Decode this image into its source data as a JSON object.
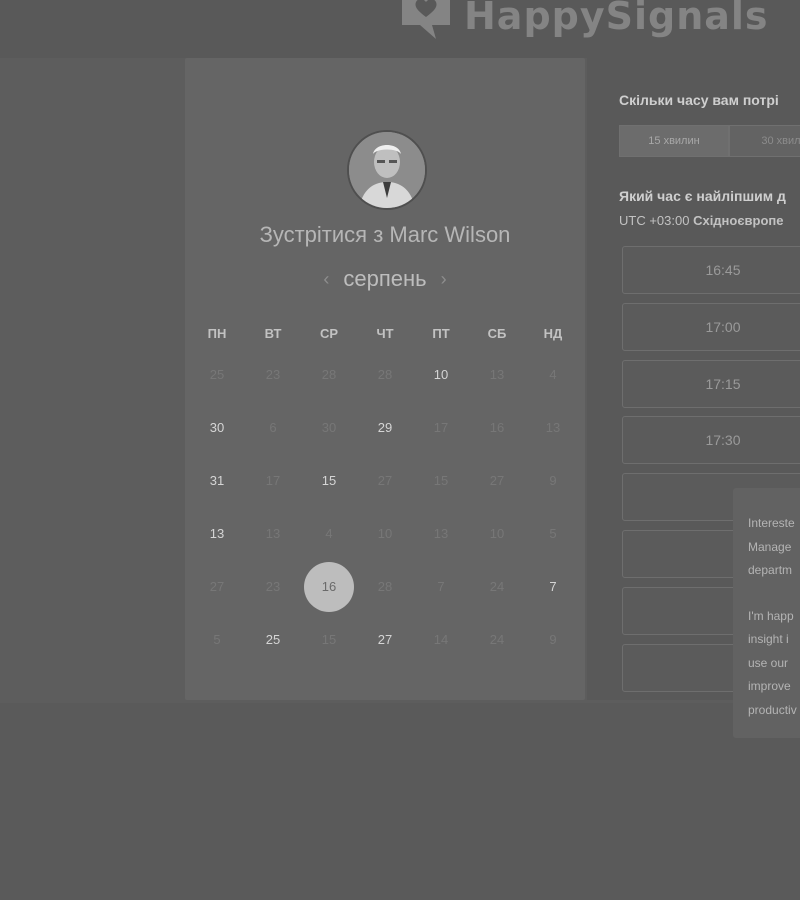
{
  "brand": {
    "name": "HappySignals"
  },
  "host": {
    "title_prefix": "Зустрітися з",
    "name": "Marc Wilson",
    "avatar_icon": "person-avatar"
  },
  "calendar": {
    "month": "серпень",
    "weekdays": [
      "ПН",
      "ВТ",
      "СР",
      "ЧТ",
      "ПТ",
      "СБ",
      "НД"
    ],
    "weeks": [
      [
        {
          "d": "25",
          "active": false
        },
        {
          "d": "23",
          "active": false
        },
        {
          "d": "28",
          "active": false
        },
        {
          "d": "28",
          "active": false
        },
        {
          "d": "10",
          "active": true
        },
        {
          "d": "13",
          "active": false
        },
        {
          "d": "4",
          "active": false
        }
      ],
      [
        {
          "d": "30",
          "active": true
        },
        {
          "d": "6",
          "active": false
        },
        {
          "d": "30",
          "active": false
        },
        {
          "d": "29",
          "active": true
        },
        {
          "d": "17",
          "active": false
        },
        {
          "d": "16",
          "active": false
        },
        {
          "d": "13",
          "active": false
        }
      ],
      [
        {
          "d": "31",
          "active": true
        },
        {
          "d": "17",
          "active": false
        },
        {
          "d": "15",
          "active": true
        },
        {
          "d": "27",
          "active": false
        },
        {
          "d": "15",
          "active": false
        },
        {
          "d": "27",
          "active": false
        },
        {
          "d": "9",
          "active": false
        }
      ],
      [
        {
          "d": "13",
          "active": true
        },
        {
          "d": "13",
          "active": false
        },
        {
          "d": "4",
          "active": false
        },
        {
          "d": "10",
          "active": false
        },
        {
          "d": "13",
          "active": false
        },
        {
          "d": "10",
          "active": false
        },
        {
          "d": "5",
          "active": false
        }
      ],
      [
        {
          "d": "27",
          "active": false
        },
        {
          "d": "23",
          "active": false
        },
        {
          "d": "16",
          "active": true,
          "selected": true
        },
        {
          "d": "28",
          "active": false
        },
        {
          "d": "7",
          "active": false
        },
        {
          "d": "24",
          "active": false
        },
        {
          "d": "7",
          "active": true
        }
      ],
      [
        {
          "d": "5",
          "active": false
        },
        {
          "d": "25",
          "active": true
        },
        {
          "d": "15",
          "active": false
        },
        {
          "d": "27",
          "active": true
        },
        {
          "d": "14",
          "active": false
        },
        {
          "d": "24",
          "active": false
        },
        {
          "d": "9",
          "active": false
        }
      ]
    ]
  },
  "scheduler": {
    "duration_question": "Скільки часу вам потрі",
    "durations": [
      "15 хвилин",
      "30 хвили"
    ],
    "time_question": "Який час є найліпшим д",
    "tz_offset": "UTC +03:00",
    "tz_name": "Східноєвропе",
    "slots": [
      "16:45",
      "17:00",
      "17:15",
      "17:30",
      "",
      "",
      "",
      ""
    ]
  },
  "popup": {
    "lines1": [
      "Intereste",
      "Manage",
      "departm"
    ],
    "lines2": [
      "I'm happ",
      "insight i",
      "use our",
      "improve",
      "productiv"
    ]
  }
}
